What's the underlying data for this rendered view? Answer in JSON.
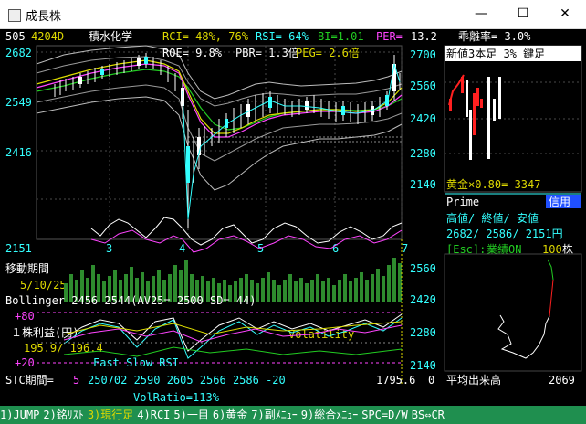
{
  "window": {
    "title": "成長株",
    "minimize": "—",
    "maximize": "☐",
    "close": "✕"
  },
  "header": {
    "code": "505",
    "ticker": "4204D",
    "name": "積水化学",
    "rci": "RCI=  48%,  76%",
    "rsi": "RSI= 64%",
    "bi": "BI=1.01",
    "per_label": "PER=",
    "per_value": "13.2",
    "deviation": "乖離率=  3.0%",
    "roe": "ROE=  9.8%",
    "pbr": "PBR= 1.3倍",
    "peg": "PEG= 2.6倍"
  },
  "main_chart": {
    "y_ticks": [
      "2682",
      "2549",
      "2416",
      "2151"
    ],
    "x_ticks": [
      "3",
      "4",
      "5",
      "6",
      "7"
    ]
  },
  "right_chart": {
    "label": "新値3本足   3% 鍵足",
    "y_ticks": [
      "2700",
      "2560",
      "2420",
      "2280",
      "2140"
    ],
    "gold_ratio": "黄金×0.80= 3347"
  },
  "info": {
    "market": "Prime",
    "credit": "信用",
    "hl_label": "高値/ 終値/ 安値",
    "hl_values": "2682/ 2586/ 2151円",
    "esc_prefix": "[Esc]:",
    "esc_label": "業績ON",
    "esc_value": "100",
    "esc_unit": "株"
  },
  "vol": {
    "label": "移動期間",
    "period": "5/10/25",
    "right_ticks": [
      "2560",
      "2420",
      "2280",
      "2140"
    ]
  },
  "bollinger": {
    "text": "Bollinger  2456  2544(AV25= 2500 SD=  44)"
  },
  "stc": {
    "plus80": "+80",
    "eps_label": "１株利益(円)",
    "eps_values": "195.9/ 196.4",
    "volatility": "Volatility",
    "plus20": "+20",
    "fast_slow": "Fast Slow RSI",
    "period_label": "STC期間=",
    "period_value": "5",
    "values": "250702  2590  2605  2566  2586 -20",
    "right_value": "1795.6",
    "volratio": "VolRatio=113%"
  },
  "bottom_right": {
    "label": "平均出来高",
    "value": "2069",
    "zero": "0"
  },
  "fkeys": [
    "1)JUMP",
    "2)銘ﾘｽﾄ",
    "3)現行足",
    "4)RCI",
    "5)一目",
    "6)黄金",
    "7)副ﾒﾆｭｰ",
    "9)総合ﾒﾆｭｰ",
    "SPC=D/W",
    "BS⇔CR"
  ],
  "colors": {
    "background": "#000000",
    "grid": "#4a4a4a",
    "bbands": "#bbbbbb",
    "ma_green": "#22cc22",
    "ma_magenta": "#ff44ff",
    "ma_yellow": "#dddd00",
    "price_cyan": "#33ffff",
    "volume": "#2e8b2e",
    "fkey_bar": "#1f8f4f",
    "rise": "#ff2020",
    "fall": "#ffffff"
  }
}
